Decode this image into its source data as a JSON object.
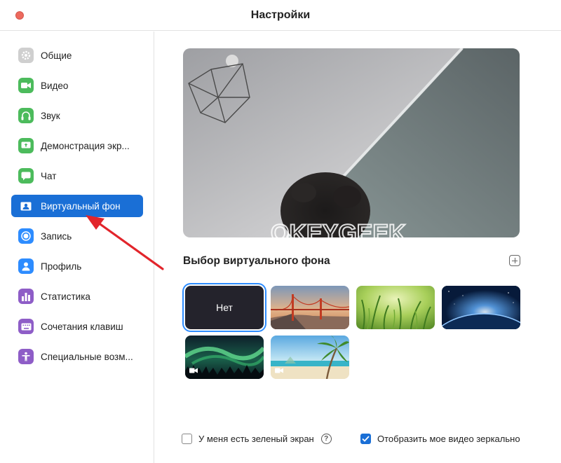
{
  "window": {
    "title": "Настройки"
  },
  "sidebar": {
    "items": [
      {
        "label": "Общие",
        "icon": "gear-icon",
        "color": "#c8c8c8"
      },
      {
        "label": "Видео",
        "icon": "video-camera-icon",
        "color": "#4cbb5c"
      },
      {
        "label": "Звук",
        "icon": "headphones-icon",
        "color": "#4cbb5c"
      },
      {
        "label": "Демонстрация экр...",
        "icon": "share-screen-icon",
        "color": "#4cbb5c"
      },
      {
        "label": "Чат",
        "icon": "chat-bubble-icon",
        "color": "#4cbb5c"
      },
      {
        "label": "Виртуальный фон",
        "icon": "virtual-background-icon",
        "color": "#1a6fd6",
        "active": true
      },
      {
        "label": "Запись",
        "icon": "record-icon",
        "color": "#2d8cff"
      },
      {
        "label": "Профиль",
        "icon": "person-icon",
        "color": "#2d8cff"
      },
      {
        "label": "Статистика",
        "icon": "bar-chart-icon",
        "color": "#8e5dc7"
      },
      {
        "label": "Сочетания клавиш",
        "icon": "keyboard-icon",
        "color": "#8e5dc7"
      },
      {
        "label": "Специальные возм...",
        "icon": "accessibility-icon",
        "color": "#8e5dc7"
      }
    ]
  },
  "preview": {
    "watermark": "OKEYGEEK"
  },
  "backgrounds": {
    "section_title": "Выбор виртуального фона",
    "none_label": "Нет",
    "thumbnails": [
      {
        "name": "none",
        "selected": true
      },
      {
        "name": "golden-gate-bridge"
      },
      {
        "name": "grass"
      },
      {
        "name": "earth-from-space"
      },
      {
        "name": "northern-lights",
        "video": true
      },
      {
        "name": "palm-beach",
        "video": true
      }
    ]
  },
  "options": {
    "green_screen_label": "У меня есть зеленый экран",
    "green_screen_checked": false,
    "mirror_label": "Отобразить мое видео зеркально",
    "mirror_checked": true
  },
  "colors": {
    "accent": "#1a6fd6",
    "close": "#ed6a5e"
  }
}
